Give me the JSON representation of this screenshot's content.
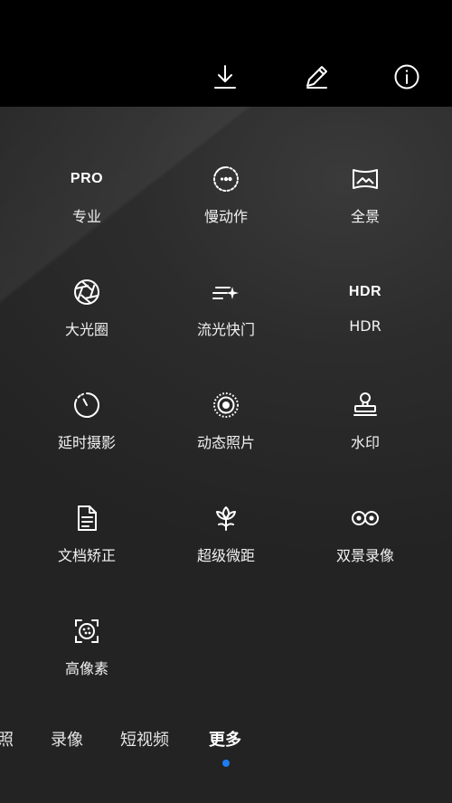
{
  "top_actions": [
    {
      "icon": "download-icon"
    },
    {
      "icon": "edit-pencil-icon"
    },
    {
      "icon": "info-icon"
    }
  ],
  "modes": [
    {
      "label": "专业",
      "icon": "pro-icon",
      "icon_text": "PRO"
    },
    {
      "label": "慢动作",
      "icon": "slow-motion-icon"
    },
    {
      "label": "全景",
      "icon": "panorama-icon"
    },
    {
      "label": "大光圈",
      "icon": "aperture-icon"
    },
    {
      "label": "流光快门",
      "icon": "light-painting-icon"
    },
    {
      "label": "HDR",
      "icon": "hdr-icon",
      "icon_text": "HDR"
    },
    {
      "label": "延时摄影",
      "icon": "time-lapse-icon"
    },
    {
      "label": "动态照片",
      "icon": "moving-picture-icon"
    },
    {
      "label": "水印",
      "icon": "watermark-stamp-icon"
    },
    {
      "label": "文档矫正",
      "icon": "document-icon"
    },
    {
      "label": "超级微距",
      "icon": "macro-flower-icon"
    },
    {
      "label": "双景录像",
      "icon": "dual-view-icon"
    },
    {
      "label": "高像素",
      "icon": "high-resolution-icon"
    }
  ],
  "bottom_tabs": {
    "photo_partial": "照",
    "video": "录像",
    "short_video": "短视频",
    "more": "更多",
    "active": "更多"
  },
  "colors": {
    "accent": "#1f7cf2",
    "panel_bg": "#2a2a2a",
    "topbar_bg": "#000000"
  }
}
